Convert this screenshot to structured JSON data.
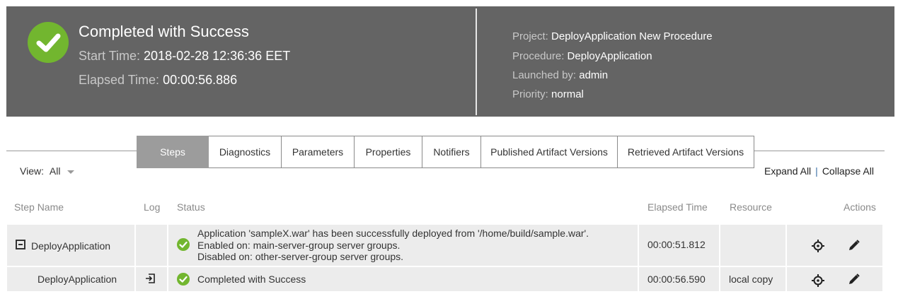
{
  "header": {
    "title": "Completed with Success",
    "start_label": "Start Time:",
    "start_value": "2018-02-28 12:36:36 EET",
    "elapsed_label": "Elapsed Time:",
    "elapsed_value": "00:00:56.886",
    "project_label": "Project:",
    "project_value": "DeployApplication New Procedure",
    "procedure_label": "Procedure:",
    "procedure_value": "DeployApplication",
    "launched_label": "Launched by:",
    "launched_value": "admin",
    "priority_label": "Priority:",
    "priority_value": "normal"
  },
  "tabs": [
    "Steps",
    "Diagnostics",
    "Parameters",
    "Properties",
    "Notifiers",
    "Published Artifact Versions",
    "Retrieved Artifact Versions"
  ],
  "active_tab": "Steps",
  "view": {
    "label": "View:",
    "value": "All"
  },
  "expand_all": "Expand All",
  "collapse_all": "Collapse All",
  "columns": [
    "Step Name",
    "Log",
    "Status",
    "Elapsed Time",
    "Resource",
    "Actions"
  ],
  "rows": [
    {
      "name": "DeployApplication",
      "status_lines": [
        "Application 'sampleX.war' has been successfully deployed from '/home/build/sample.war'.",
        "Enabled on: main-server-group server groups.",
        "Disabled on: other-server-group server groups."
      ],
      "elapsed": "00:00:51.812",
      "resource": ""
    },
    {
      "name": "DeployApplication",
      "status_lines": [
        "Completed with Success"
      ],
      "elapsed": "00:00:56.590",
      "resource": "local copy"
    }
  ],
  "colors": {
    "header_bg": "#646464",
    "success": "#72b62f",
    "active_tab": "#9c9c9c",
    "row_bg": "#ececec"
  },
  "icons": {
    "success": "check-circle-icon",
    "collapse": "minus-square-icon",
    "log": "log-icon",
    "locate": "crosshair-icon",
    "edit": "pencil-icon"
  }
}
